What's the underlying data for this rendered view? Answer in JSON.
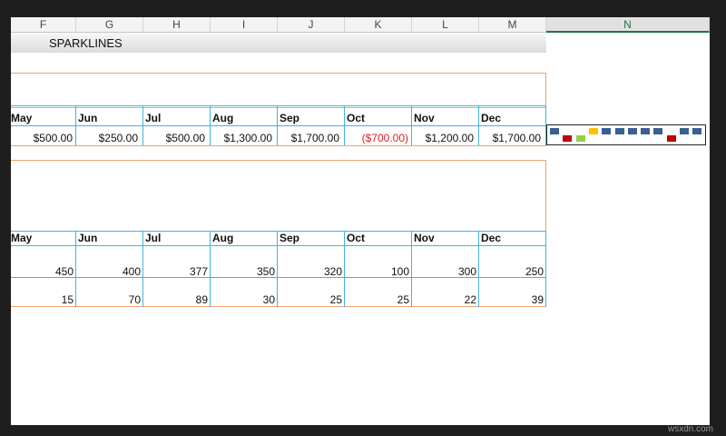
{
  "columns": [
    "F",
    "G",
    "H",
    "I",
    "J",
    "K",
    "L",
    "M",
    "N"
  ],
  "title": "SPARKLINES",
  "table1": {
    "months": [
      "May",
      "Jun",
      "Jul",
      "Aug",
      "Sep",
      "Oct",
      "Nov",
      "Dec"
    ],
    "values": [
      "$500.00",
      "$250.00",
      "$500.00",
      "$1,300.00",
      "$1,700.00",
      "($700.00)",
      "$1,200.00",
      "$1,700.00"
    ]
  },
  "sparkline": {
    "colors": {
      "normal": "#3a5f91",
      "negative": "#c00000",
      "high": "#ffc000",
      "low": "#92d050"
    },
    "bars": [
      {
        "level": "up",
        "color": "normal"
      },
      {
        "level": "down",
        "color": "negative"
      },
      {
        "level": "down",
        "color": "low"
      },
      {
        "level": "up",
        "color": "high"
      },
      {
        "level": "up",
        "color": "normal"
      },
      {
        "level": "up",
        "color": "normal"
      },
      {
        "level": "up",
        "color": "normal"
      },
      {
        "level": "up",
        "color": "normal"
      },
      {
        "level": "up",
        "color": "normal"
      },
      {
        "level": "down",
        "color": "negative"
      },
      {
        "level": "up",
        "color": "normal"
      },
      {
        "level": "up",
        "color": "normal"
      }
    ]
  },
  "table2": {
    "months": [
      "May",
      "Jun",
      "Jul",
      "Aug",
      "Sep",
      "Oct",
      "Nov",
      "Dec"
    ],
    "row1": [
      "450",
      "400",
      "377",
      "350",
      "320",
      "100",
      "300",
      "250"
    ],
    "row2": [
      "15",
      "70",
      "89",
      "30",
      "25",
      "25",
      "22",
      "39"
    ]
  },
  "watermark": "wsxdn.com"
}
